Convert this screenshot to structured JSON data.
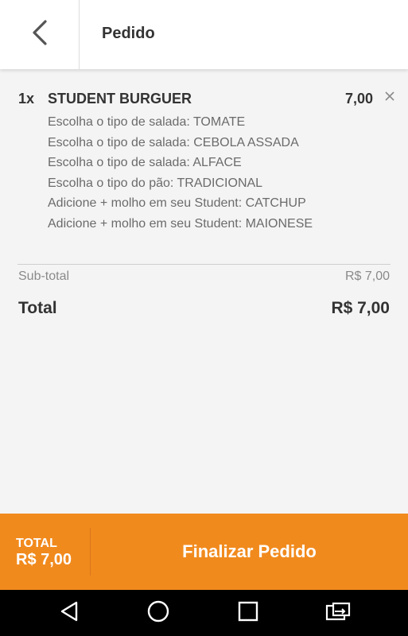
{
  "header": {
    "title": "Pedido"
  },
  "order_item": {
    "quantity": "1x",
    "name": "STUDENT BURGUER",
    "price": "7,00",
    "options": [
      "Escolha o tipo de salada: TOMATE",
      "Escolha o tipo de salada: CEBOLA ASSADA",
      "Escolha o tipo de salada: ALFACE",
      "Escolha o tipo do pão: TRADICIONAL",
      "Adicione + molho em seu Student: CATCHUP",
      "Adicione + molho em seu Student: MAIONESE"
    ]
  },
  "summary": {
    "subtotal_label": "Sub-total",
    "subtotal_value": "R$ 7,00",
    "total_label": "Total",
    "total_value": "R$ 7,00"
  },
  "footer": {
    "total_label": "TOTAL",
    "total_value": "R$ 7,00",
    "finalize_label": "Finalizar Pedido"
  },
  "icons": {
    "back": "chevron-left-icon",
    "remove": "close-icon",
    "nav_back": "triangle-back-icon",
    "nav_home": "circle-home-icon",
    "nav_recents": "square-recents-icon",
    "nav_rotate": "screen-rotate-icon"
  },
  "colors": {
    "accent": "#f18a1d",
    "background": "#f4f4f4",
    "header": "#ffffff",
    "text": "#333333",
    "muted_text": "#6b6b6b",
    "nav_bar": "#000000"
  }
}
